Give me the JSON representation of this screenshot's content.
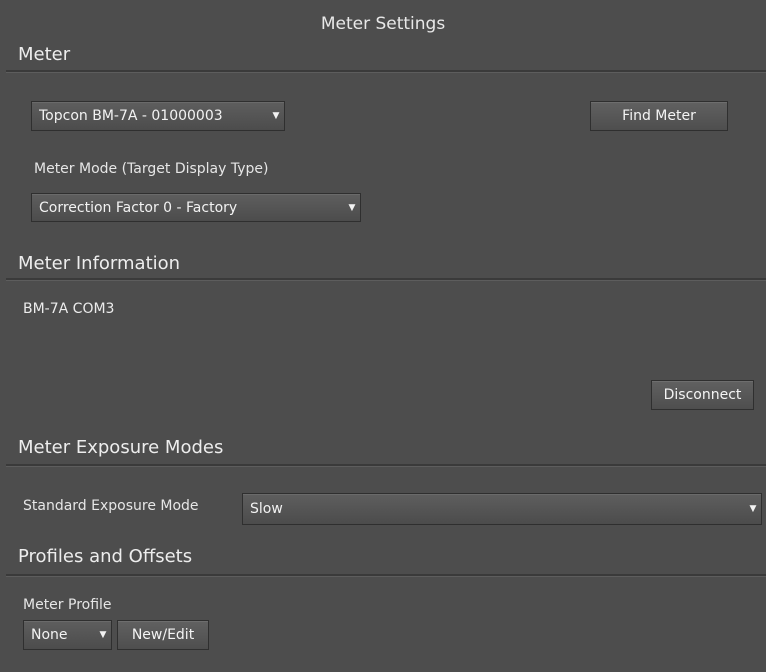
{
  "window": {
    "title": "Meter Settings"
  },
  "meter": {
    "section_title": "Meter",
    "device_select": "Topcon BM-7A - 01000003",
    "find_button": "Find Meter",
    "mode_label": "Meter Mode (Target Display Type)",
    "mode_select": "Correction Factor 0 - Factory"
  },
  "meter_information": {
    "section_title": "Meter Information",
    "info_text": "BM-7A COM3",
    "disconnect_button": "Disconnect"
  },
  "exposure": {
    "section_title": "Meter Exposure Modes",
    "standard_label": "Standard Exposure Mode",
    "standard_select": "Slow"
  },
  "profiles": {
    "section_title": "Profiles and Offsets",
    "profile_label": "Meter Profile",
    "profile_select": "None",
    "new_edit_button": "New/Edit"
  },
  "icons": {
    "dropdown_arrow": "chevron-down-icon"
  }
}
